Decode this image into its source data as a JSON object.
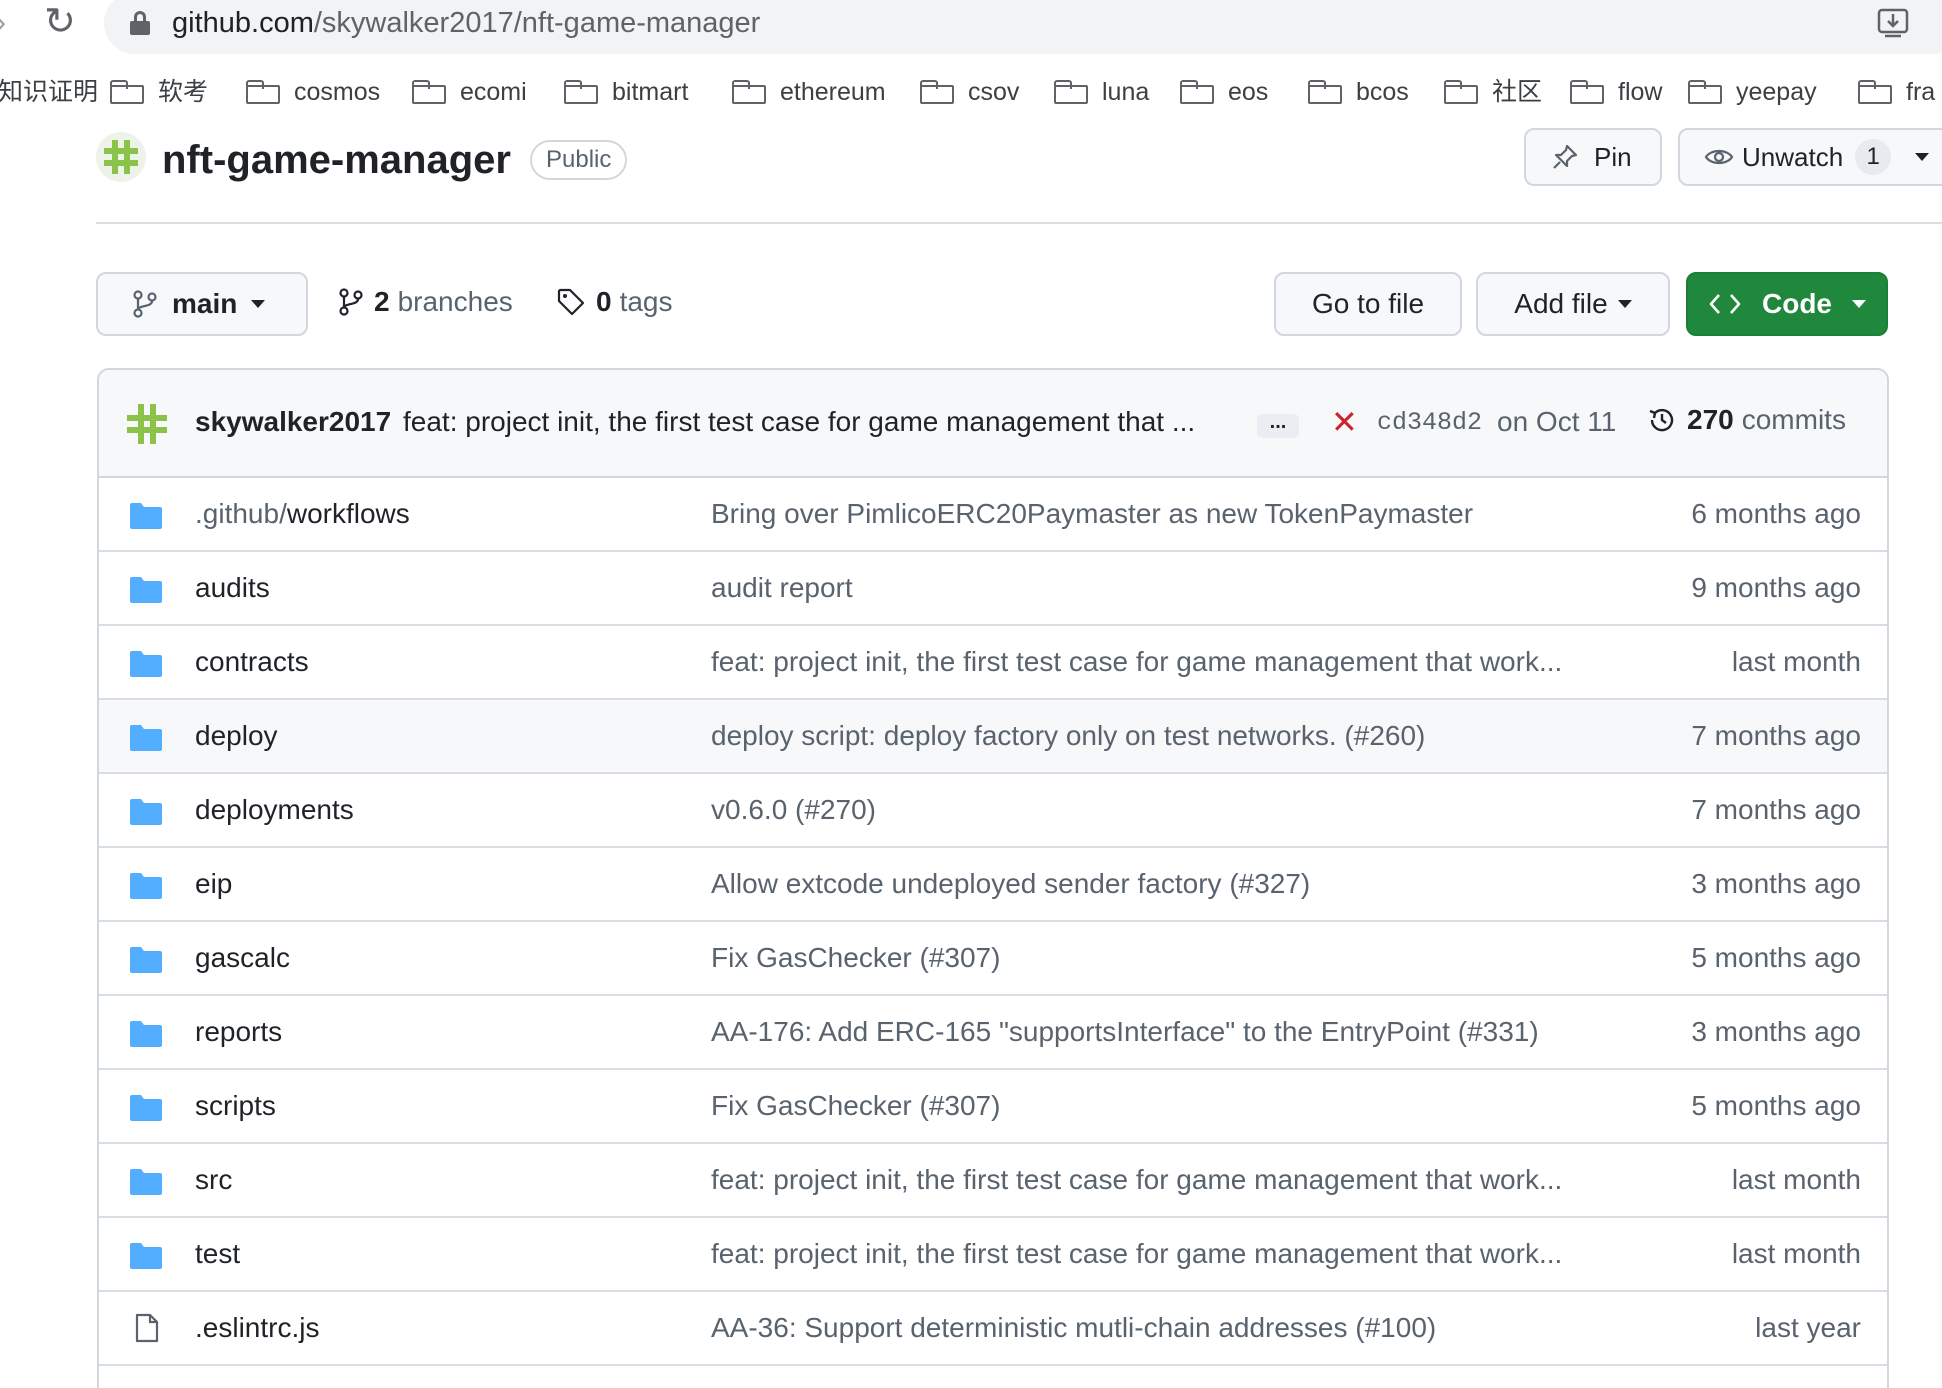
{
  "browser": {
    "url_host": "github.com",
    "url_path": "/skywalker2017/nft-game-manager",
    "bookmarks": [
      {
        "label": "知识证明",
        "folder": false
      },
      {
        "label": "软考",
        "folder": true
      },
      {
        "label": "cosmos",
        "folder": true
      },
      {
        "label": "ecomi",
        "folder": true
      },
      {
        "label": "bitmart",
        "folder": true
      },
      {
        "label": "ethereum",
        "folder": true
      },
      {
        "label": "csov",
        "folder": true
      },
      {
        "label": "luna",
        "folder": true
      },
      {
        "label": "eos",
        "folder": true
      },
      {
        "label": "bcos",
        "folder": true
      },
      {
        "label": "社区",
        "folder": true
      },
      {
        "label": "flow",
        "folder": true
      },
      {
        "label": "yeepay",
        "folder": true
      },
      {
        "label": "fra",
        "folder": true
      }
    ]
  },
  "repo": {
    "name": "nft-game-manager",
    "visibility": "Public",
    "pin_label": "Pin",
    "watch_label": "Unwatch",
    "watch_count": "1"
  },
  "toolbar": {
    "branch": "main",
    "branches_count": "2",
    "branches_label": "branches",
    "tags_count": "0",
    "tags_label": "tags",
    "go_to_file": "Go to file",
    "add_file": "Add file",
    "code": "Code"
  },
  "latest_commit": {
    "author": "skywalker2017",
    "message": "feat: project init, the first test case for game management that ...",
    "ellipsis": "...",
    "status": "failed",
    "sha": "cd348d2",
    "date": "on Oct 11",
    "commits_count": "270",
    "commits_label": "commits"
  },
  "files": [
    {
      "type": "dir",
      "name_prefix": ".github/",
      "name": "workflows",
      "message": "Bring over PimlicoERC20Paymaster as new TokenPaymaster",
      "date": "6 months ago"
    },
    {
      "type": "dir",
      "name_prefix": "",
      "name": "audits",
      "message": "audit report",
      "date": "9 months ago"
    },
    {
      "type": "dir",
      "name_prefix": "",
      "name": "contracts",
      "message": "feat: project init, the first test case for game management that work...",
      "date": "last month"
    },
    {
      "type": "dir",
      "name_prefix": "",
      "name": "deploy",
      "message": "deploy script: deploy factory only on test networks. (#260)",
      "date": "7 months ago"
    },
    {
      "type": "dir",
      "name_prefix": "",
      "name": "deployments",
      "message": "v0.6.0 (#270)",
      "date": "7 months ago"
    },
    {
      "type": "dir",
      "name_prefix": "",
      "name": "eip",
      "message": "Allow extcode undeployed sender factory (#327)",
      "date": "3 months ago"
    },
    {
      "type": "dir",
      "name_prefix": "",
      "name": "gascalc",
      "message": "Fix GasChecker (#307)",
      "date": "5 months ago"
    },
    {
      "type": "dir",
      "name_prefix": "",
      "name": "reports",
      "message": "AA-176: Add ERC-165 \"supportsInterface\" to the EntryPoint (#331)",
      "date": "3 months ago"
    },
    {
      "type": "dir",
      "name_prefix": "",
      "name": "scripts",
      "message": "Fix GasChecker (#307)",
      "date": "5 months ago"
    },
    {
      "type": "dir",
      "name_prefix": "",
      "name": "src",
      "message": "feat: project init, the first test case for game management that work...",
      "date": "last month"
    },
    {
      "type": "dir",
      "name_prefix": "",
      "name": "test",
      "message": "feat: project init, the first test case for game management that work...",
      "date": "last month"
    },
    {
      "type": "file",
      "name_prefix": "",
      "name": ".eslintrc.js",
      "message": "AA-36: Support deterministic mutli-chain addresses (#100)",
      "date": "last year"
    }
  ],
  "colors": {
    "folder": "#54aeff",
    "code_button": "#1f883d",
    "fail": "#cf222e",
    "avatar_green": "#8bc34a"
  },
  "icons": {
    "reload": "reload-icon",
    "lock": "lock-icon",
    "install": "install-icon",
    "branch": "git-branch-icon",
    "tag": "tag-icon",
    "history": "history-icon",
    "pin": "pin-icon",
    "eye": "eye-icon",
    "code": "code-icon",
    "folder": "folder-icon",
    "file": "file-icon"
  }
}
